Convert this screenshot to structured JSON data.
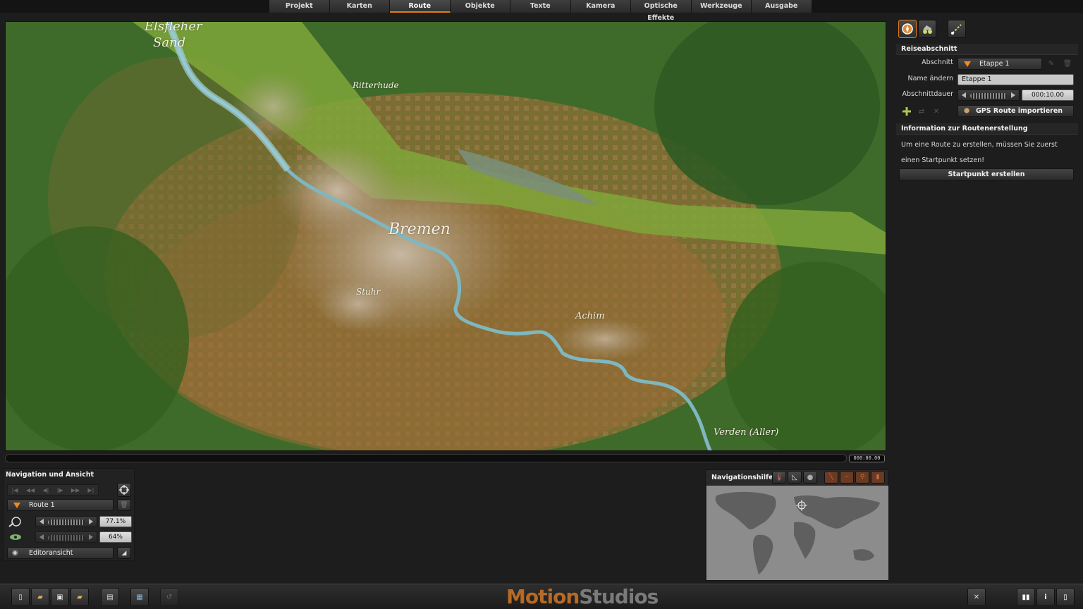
{
  "menu": {
    "tabs": [
      {
        "label": "Projekt"
      },
      {
        "label": "Karten"
      },
      {
        "label": "Route"
      },
      {
        "label": "Objekte"
      },
      {
        "label": "Texte"
      },
      {
        "label": "Kamera"
      },
      {
        "label": "Optische Effekte"
      },
      {
        "label": "Werkzeuge"
      },
      {
        "label": "Ausgabe"
      }
    ],
    "active_tab": "Route"
  },
  "map": {
    "labels": {
      "elsfleth_line1": "Elsfleher",
      "elsfleth_line2": "Sand",
      "ritterhude": "Ritterhude",
      "bremen": "Bremen",
      "stuhr": "Stuhr",
      "achim": "Achim",
      "verden": "Verden (Aller)"
    }
  },
  "timeline": {
    "timecode": "000:00.00"
  },
  "right_panel": {
    "reiseabschnitt": {
      "header": "Reiseabschnitt",
      "abschnitt_label": "Abschnitt",
      "abschnitt_value": "Etappe 1",
      "name_label": "Name ändern",
      "name_value": "Etappe 1",
      "dauer_label": "Abschnittdauer",
      "dauer_value": "000:10.00",
      "gps_button": "GPS Route importieren"
    },
    "info": {
      "header": "Information zur Routenerstellung",
      "line1": "Um eine Route zu erstellen, müssen Sie zuerst",
      "line2": "einen Startpunkt setzen!",
      "button": "Startpunkt erstellen"
    }
  },
  "nav_panel": {
    "header": "Navigation und Ansicht",
    "route_value": "Route 1",
    "zoom_value": "77.1%",
    "tilt_value": "64%",
    "view_value": "Editoransicht"
  },
  "navhelp": {
    "title": "Navigationshilfe"
  },
  "brand": {
    "part1": "Motion",
    "part2": "Studios"
  },
  "colors": {
    "accent": "#e07a1c",
    "background": "#1d1d1d",
    "panel": "#262626"
  }
}
